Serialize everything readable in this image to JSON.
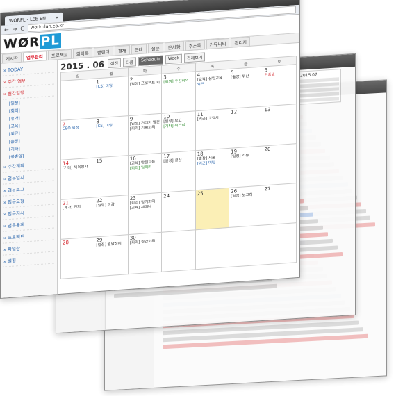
{
  "browser": {
    "tab_title": "WORPL - LEE EN",
    "tab_close": "×",
    "url": "workplan.co.kr",
    "nav_back": "←",
    "nav_forward": "→",
    "nav_reload": "C"
  },
  "app": {
    "logo_main": "W",
    "logo_rest": "ØR",
    "logo_pl": "PL",
    "menu": [
      "게시판",
      "업무관리",
      "프로젝트",
      "회의록",
      "캘린더",
      "결재",
      "근태",
      "설문",
      "문서함",
      "주소록",
      "커뮤니티",
      "관리자"
    ],
    "active_menu_index": 1
  },
  "sidebar": {
    "items": [
      {
        "label": "TODAY",
        "red": false
      },
      {
        "label": "주간 업무",
        "red": true
      },
      {
        "label": "월간일정",
        "red": true
      }
    ],
    "subitems": [
      "[일정]",
      "[회의]",
      "[휴가]",
      "[교육]",
      "[외근]",
      "[출장]",
      "[기타]",
      "[공휴일]"
    ],
    "more": [
      "주간계획",
      "업무일지",
      "업무보고",
      "업무요청",
      "업무지시",
      "업무통계",
      "프로젝트",
      "파일함",
      "설정"
    ]
  },
  "calendar": {
    "month_label": "2015 . 06",
    "buttons": [
      "이전",
      "다음",
      "Schedule",
      "Week",
      "전체보기"
    ],
    "weekdays": [
      "일",
      "월",
      "화",
      "수",
      "목",
      "금",
      "토"
    ],
    "weeks": [
      [
        {
          "d": "",
          "ev": []
        },
        {
          "d": "1",
          "ev": [
            {
              "t": "[CS] 미팅",
              "c": "blue"
            }
          ]
        },
        {
          "d": "2",
          "ev": [
            {
              "t": "[일정] 프로젝트 회의",
              "c": ""
            }
          ]
        },
        {
          "d": "3",
          "ev": [
            {
              "t": "[회의] 주간회의",
              "c": "green"
            }
          ]
        },
        {
          "d": "4",
          "ev": [
            {
              "t": "[교육] 신입교육",
              "c": ""
            },
            {
              "t": "외근",
              "c": "blue"
            }
          ]
        },
        {
          "d": "5",
          "ev": [
            {
              "t": "[출장] 부산",
              "c": ""
            }
          ]
        },
        {
          "d": "6",
          "ev": [
            {
              "t": "현충일",
              "c": "red"
            }
          ]
        }
      ],
      [
        {
          "d": "7",
          "ev": [
            {
              "t": "CEO 일정",
              "c": "blue"
            }
          ]
        },
        {
          "d": "8",
          "ev": [
            {
              "t": "[CS] 미팅",
              "c": "blue"
            }
          ]
        },
        {
          "d": "9",
          "ev": [
            {
              "t": "[일정] 거래처 방문",
              "c": ""
            },
            {
              "t": "[회의] 기획회의",
              "c": ""
            }
          ]
        },
        {
          "d": "10",
          "ev": [
            {
              "t": "[일정] 보고",
              "c": ""
            },
            {
              "t": "[기타] 워크샵",
              "c": "green"
            }
          ]
        },
        {
          "d": "11",
          "ev": [
            {
              "t": "[외근] 고객사",
              "c": ""
            }
          ]
        },
        {
          "d": "12",
          "ev": []
        },
        {
          "d": "13",
          "ev": []
        }
      ],
      [
        {
          "d": "14",
          "ev": [
            {
              "t": "[기타] 체육행사",
              "c": ""
            }
          ]
        },
        {
          "d": "15",
          "ev": []
        },
        {
          "d": "16",
          "ev": [
            {
              "t": "[교육] 안전교육",
              "c": ""
            },
            {
              "t": "[회의] 팀회의",
              "c": "green"
            }
          ]
        },
        {
          "d": "17",
          "ev": [
            {
              "t": "[일정] 결산",
              "c": ""
            }
          ]
        },
        {
          "d": "18",
          "ev": [
            {
              "t": "[출장] 서울",
              "c": ""
            },
            {
              "t": "[외근] 미팅",
              "c": "blue"
            }
          ]
        },
        {
          "d": "19",
          "ev": [
            {
              "t": "[일정] 리뷰",
              "c": ""
            }
          ]
        },
        {
          "d": "20",
          "ev": []
        }
      ],
      [
        {
          "d": "21",
          "ev": [
            {
              "t": "[휴가] 연차",
              "c": ""
            }
          ]
        },
        {
          "d": "22",
          "ev": [
            {
              "t": "[일정] 마감",
              "c": ""
            }
          ]
        },
        {
          "d": "23",
          "ev": [
            {
              "t": "[회의] 정기회의",
              "c": ""
            },
            {
              "t": "[교육] 세미나",
              "c": ""
            }
          ]
        },
        {
          "d": "24",
          "ev": []
        },
        {
          "d": "25",
          "ev": [],
          "hl": true
        },
        {
          "d": "26",
          "ev": [
            {
              "t": "[일정] 보고회",
              "c": ""
            }
          ]
        },
        {
          "d": "27",
          "ev": []
        }
      ],
      [
        {
          "d": "28",
          "ev": []
        },
        {
          "d": "29",
          "ev": [
            {
              "t": "[일정] 월말정리",
              "c": ""
            }
          ]
        },
        {
          "d": "30",
          "ev": [
            {
              "t": "[회의] 월간회의",
              "c": ""
            }
          ]
        },
        {
          "d": "",
          "ev": []
        },
        {
          "d": "",
          "ev": []
        },
        {
          "d": "",
          "ev": []
        },
        {
          "d": "",
          "ev": []
        }
      ]
    ]
  },
  "back_window": {
    "mini_cal_title": "2015.07"
  },
  "colors": {
    "accent": "#1f9ad6",
    "red": "#d2232a",
    "blue": "#1e5da8",
    "highlight": "#fbefb6"
  }
}
